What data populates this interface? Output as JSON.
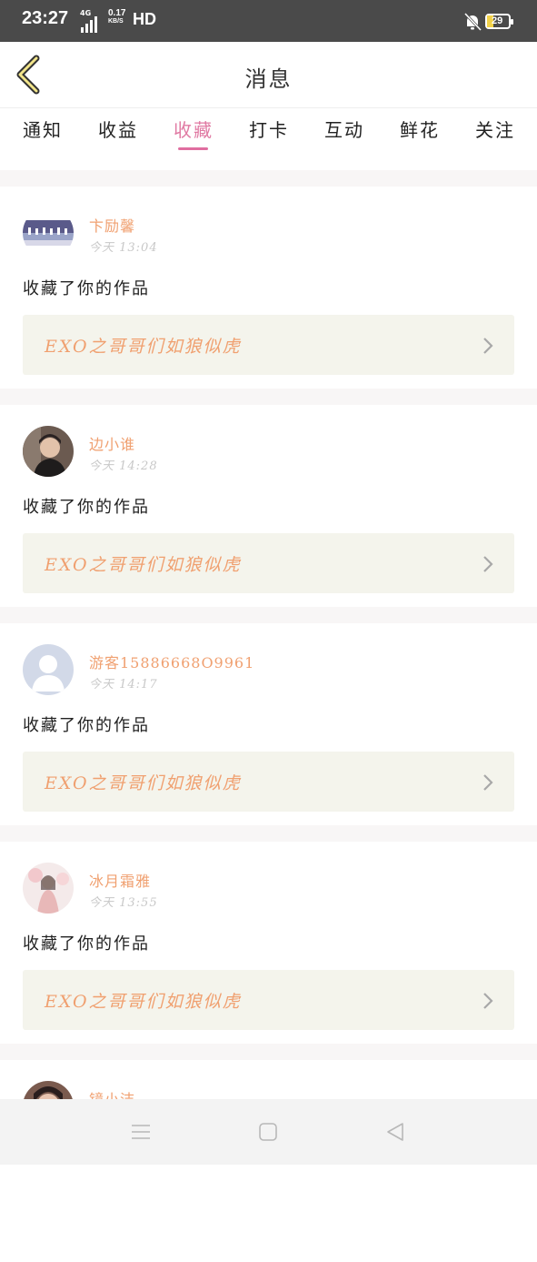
{
  "status_bar": {
    "time": "23:27",
    "network": "4G",
    "speed_value": "0.17",
    "speed_unit": "KB/S",
    "hd": "HD",
    "battery": "29",
    "bell_icon": "bell-off-icon"
  },
  "header": {
    "title": "消息",
    "back_icon": "back-chevron-icon"
  },
  "tabs": [
    {
      "label": "通知"
    },
    {
      "label": "收益"
    },
    {
      "label": "收藏",
      "active": true
    },
    {
      "label": "打卡"
    },
    {
      "label": "互动"
    },
    {
      "label": "鲜花"
    },
    {
      "label": "关注"
    }
  ],
  "messages": [
    {
      "user": "卞励馨",
      "time": "今天 13:04",
      "action": "收藏了你的作品",
      "work": "EXO之哥哥们如狼似虎",
      "avatar": "group-photo-avatar"
    },
    {
      "user": "边小谁",
      "time": "今天 14:28",
      "action": "收藏了你的作品",
      "work": "EXO之哥哥们如狼似虎",
      "avatar": "person-photo-avatar"
    },
    {
      "user": "游客15886668O9961",
      "time": "今天 14:17",
      "action": "收藏了你的作品",
      "work": "EXO之哥哥们如狼似虎",
      "avatar": "default-user-avatar"
    },
    {
      "user": "冰月霜雅",
      "time": "今天 13:55",
      "action": "收藏了你的作品",
      "work": "EXO之哥哥们如狼似虎",
      "avatar": "illustration-avatar"
    },
    {
      "user": "镜小洁",
      "avatar": "person-photo-avatar"
    }
  ],
  "colors": {
    "accent": "#e06ea0",
    "username": "#f0a070",
    "work_box": "#f4f4ec",
    "status_bar": "#4a4a4a"
  },
  "bottom_nav": [
    "menu-icon",
    "home-square-icon",
    "back-triangle-icon"
  ]
}
